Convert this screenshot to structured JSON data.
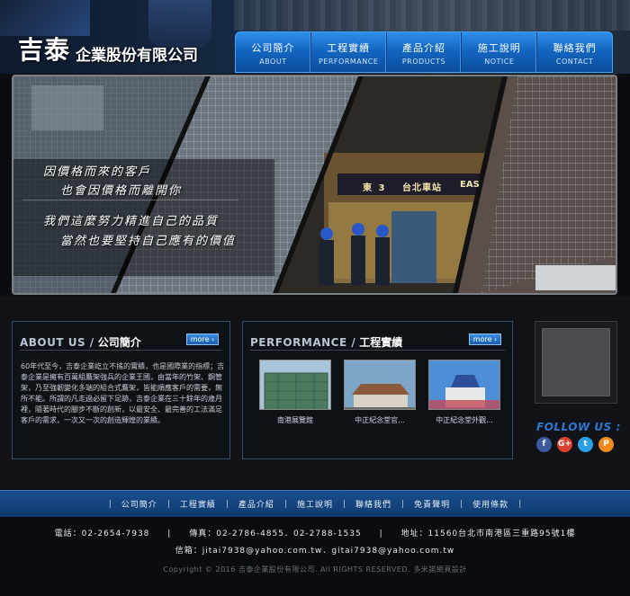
{
  "brand": {
    "name_big": "吉泰",
    "name_small": "企業股份有限公司"
  },
  "nav": [
    {
      "zh": "公司簡介",
      "en": "ABOUT"
    },
    {
      "zh": "工程實績",
      "en": "PERFORMANCE"
    },
    {
      "zh": "產品介紹",
      "en": "PRODUCTS"
    },
    {
      "zh": "施工說明",
      "en": "NOTICE"
    },
    {
      "zh": "聯絡我們",
      "en": "CONTACT"
    }
  ],
  "banner": {
    "line1": "因價格而來的客戶",
    "line2": "也會因價格而離開你",
    "line3": "我們這麼努力精進自己的品質",
    "line4": "當然也要堅持自己應有的價值",
    "sign_left": "東 3",
    "sign_mid": "台北車站",
    "sign_right": "EAS"
  },
  "about": {
    "title_en": "ABOUT US /",
    "title_zh": "公司簡介",
    "more": "more ›",
    "text": "60年代至今，吉泰企業屹立不搖的實績，也是國際業的指標；吉泰企業是擁有百萬組鷹架強兵的企業王國，由當年的竹架、鋼管架，乃至強韌變化多端的組合式鷹架，皆能順應客戶的需要，無所不能。所謂的凡走過必留下足跡，吉泰企業在三十餘年的歲月裡，隨著時代的腳步不斷的創新，以最安全、最完善的工法滿足客戶的需求，一次又一次的創造輝煌的業績。"
  },
  "performance": {
    "title_en": "PERFORMANCE /",
    "title_zh": "工程實績",
    "more": "more ›",
    "items": [
      {
        "caption": "南港展覽館"
      },
      {
        "caption": "中正紀念堂官..."
      },
      {
        "caption": "中正紀念堂外觀..."
      }
    ]
  },
  "follow": {
    "label": "FOLLOW US :",
    "icons": [
      "facebook-icon",
      "google-plus-icon",
      "twitter-icon",
      "plurk-icon"
    ]
  },
  "footer_nav": [
    "公司簡介",
    "工程實績",
    "產品介紹",
    "施工說明",
    "聯絡我們",
    "免責聲明",
    "使用條款"
  ],
  "contact": {
    "phone": "電話：02-2654-7938",
    "fax": "傳真：02-2786-4855．02-2788-1535",
    "address": "地址：11560台北市南港區三重路95號1樓",
    "email": "信箱：jitai7938@yahoo.com.tw．gitai7938@yahoo.com.tw"
  },
  "copyright": "Copyright © 2016 吉泰企業股份有限公司. All RIGHTS RESERVED. 多米諾網頁設計",
  "colors": {
    "nav_blue": "#1366c2",
    "follow_blue": "#2f78d0",
    "facebook": "#3b5aa0",
    "google": "#d8432f",
    "twitter": "#2aa1e6",
    "plurk": "#f08a1c"
  }
}
